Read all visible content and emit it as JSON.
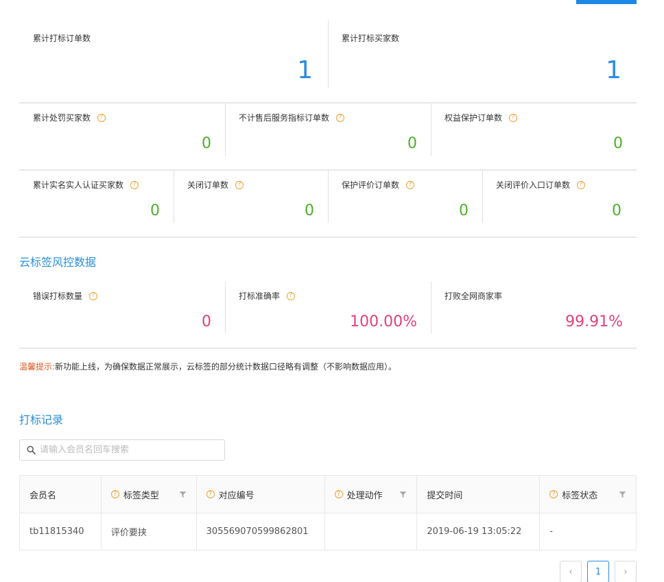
{
  "summary": {
    "row1": [
      {
        "label": "累计打标订单数",
        "value": "1"
      },
      {
        "label": "累计打标买家数",
        "value": "1"
      }
    ],
    "row2": [
      {
        "label": "累计处罚买家数",
        "value": "0"
      },
      {
        "label": "不计售后服务指标订单数",
        "value": "0"
      },
      {
        "label": "权益保护订单数",
        "value": "0"
      }
    ],
    "row3": [
      {
        "label": "累计实名实人认证买家数",
        "value": "0"
      },
      {
        "label": "关闭订单数",
        "value": "0"
      },
      {
        "label": "保护评价订单数",
        "value": "0"
      },
      {
        "label": "关闭评价入口订单数",
        "value": "0"
      }
    ]
  },
  "risk": {
    "title": "云标签风控数据",
    "items": [
      {
        "label": "错误打标数量",
        "value": "0"
      },
      {
        "label": "打标准确率",
        "value": "100.00%"
      },
      {
        "label": "打败全网商家率",
        "value": "99.91%"
      }
    ]
  },
  "tip": {
    "label": "温馨提示:",
    "text": "新功能上线，为确保数据正常展示，云标签的部分统计数据口径略有调整（不影响数据应用）。"
  },
  "records": {
    "title": "打标记录",
    "search_placeholder": "请输入会员名回车搜索",
    "columns": [
      "会员名",
      "标签类型",
      "对应编号",
      "处理动作",
      "提交时间",
      "标签状态"
    ],
    "rows": [
      [
        "tb11815340",
        "评价要挟",
        "305569070599862801",
        "",
        "2019-06-19 13:05:22",
        "-"
      ]
    ]
  },
  "pagination": {
    "prev": "‹",
    "current": "1",
    "next": "›"
  },
  "colors": {
    "accent_blue": "#2c8be0",
    "green": "#4caf2a",
    "pink": "#e4407b",
    "warning": "#e0561c",
    "help_icon": "#f0a030"
  }
}
